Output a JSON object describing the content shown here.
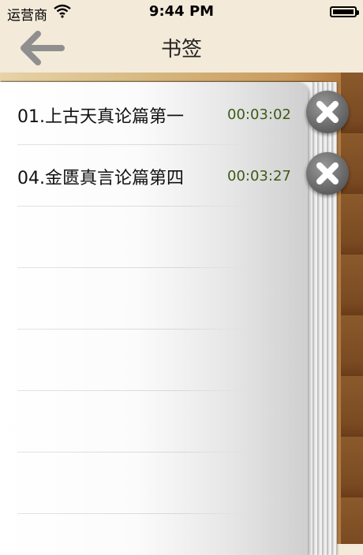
{
  "status_bar": {
    "carrier": "运营商",
    "time": "9:44 PM"
  },
  "nav": {
    "title": "书签"
  },
  "bookmarks": [
    {
      "title": "01.上古天真论篇第一",
      "time": "00:03:02"
    },
    {
      "title": "04.金匮真言论篇第四",
      "time": "00:03:27"
    }
  ],
  "icons": {
    "back": "back-arrow-icon",
    "delete": "delete-icon",
    "wifi": "wifi-icon",
    "battery": "battery-icon"
  },
  "colors": {
    "time_text": "#3c5a16",
    "background": "#f4ead9"
  }
}
